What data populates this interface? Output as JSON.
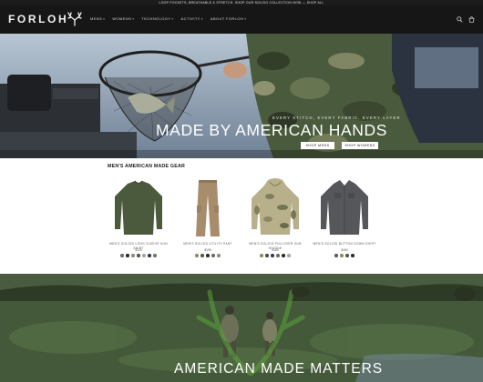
{
  "announcement": "LOOP POCKETS, BREATHABLE & STRETCH. SHOP OUR SOLOID COLLECTION NOW — SHOP ALL",
  "brand": {
    "logo_text": "FORLOH"
  },
  "nav": {
    "items": [
      {
        "label": "MENS"
      },
      {
        "label": "WOMENS"
      },
      {
        "label": "TECHNOLOGY"
      },
      {
        "label": "ACTIVITY"
      },
      {
        "label": "ABOUT FORLOH"
      }
    ]
  },
  "header_icons": [
    "search-icon",
    "cart-icon"
  ],
  "hero": {
    "tagline": "EVERY STITCH, EVERY FABRIC, EVERY LAYER",
    "title": "MADE BY AMERICAN HANDS",
    "shop_men": "SHOP MENS",
    "shop_women": "SHOP WOMENS"
  },
  "products_section": {
    "title": "MEN'S AMERICAN MADE GEAR",
    "products": [
      {
        "name": "MEN'S SOLOID LONG SLEEVE SUN SHIRT",
        "price": "$120",
        "colors": [
          "#6b6e5c",
          "#2c2c2c",
          "#8a8f7c",
          "#4a5a48",
          "#a8a99b",
          "#2d3b52",
          "#6b7a60"
        ]
      },
      {
        "name": "MEN'S SOLOID UTILITY PANT",
        "price": "$195",
        "colors": [
          "#9c8468",
          "#4a5a48",
          "#2c2c2c",
          "#6b6e5c",
          "#8a8f7c"
        ]
      },
      {
        "name": "MEN'S SOLOID PULLOVER SUN HOODIE",
        "price": "$160",
        "colors": [
          "#8f8a60",
          "#4a4a4a",
          "#2d3b52",
          "#6b6e5c",
          "#2c2c2c",
          "#a8a99b"
        ]
      },
      {
        "name": "MEN'S SOLOID BUTTON DOWN SHIRT",
        "price": "$150",
        "colors": [
          "#5a5a5a",
          "#8f8a60",
          "#4a5a48",
          "#2c2c2c"
        ]
      }
    ]
  },
  "banner": {
    "title": "AMERICAN MADE MATTERS"
  }
}
